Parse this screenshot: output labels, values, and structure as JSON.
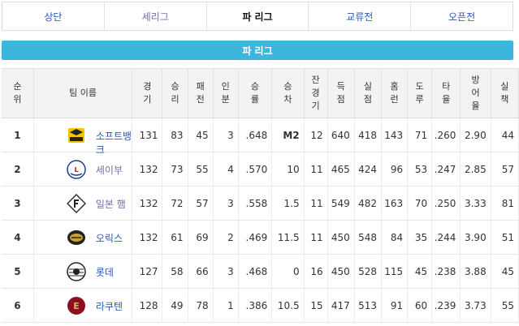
{
  "tabs": [
    {
      "label": "상단",
      "style": "link"
    },
    {
      "label": "세리그",
      "style": "muted"
    },
    {
      "label": "파 리그",
      "style": "active"
    },
    {
      "label": "교류전",
      "style": "link"
    },
    {
      "label": "오픈전",
      "style": "link"
    }
  ],
  "banner": {
    "title": "파 리그"
  },
  "table": {
    "headers": [
      "순위",
      "팀 이름",
      "경기",
      "승리",
      "패전",
      "인분",
      "승률",
      "승차",
      "잔경기",
      "득점",
      "실점",
      "홈런",
      "도루",
      "타율",
      "방어율",
      "실책"
    ],
    "rows": [
      {
        "rank": "1",
        "team": "소프트뱅크",
        "logo": "hawks-logo",
        "link_style": "blue",
        "g": "131",
        "w": "83",
        "l": "45",
        "d": "3",
        "pct": ".648",
        "gb": "M2",
        "gb_bold": true,
        "rem": "12",
        "rs": "640",
        "ra": "418",
        "hr": "143",
        "sb": "71",
        "avg": ".260",
        "era": "2.90",
        "err": "44"
      },
      {
        "rank": "2",
        "team": "세이부",
        "logo": "lions-logo",
        "link_style": "purple",
        "g": "132",
        "w": "73",
        "l": "55",
        "d": "4",
        "pct": ".570",
        "gb": "10",
        "gb_bold": false,
        "rem": "11",
        "rs": "465",
        "ra": "424",
        "hr": "96",
        "sb": "53",
        "avg": ".247",
        "era": "2.85",
        "err": "57"
      },
      {
        "rank": "3",
        "team": "일본 햄",
        "logo": "fighters-logo",
        "link_style": "purple",
        "g": "132",
        "w": "72",
        "l": "57",
        "d": "3",
        "pct": ".558",
        "gb": "1.5",
        "gb_bold": false,
        "rem": "11",
        "rs": "549",
        "ra": "482",
        "hr": "163",
        "sb": "70",
        "avg": ".250",
        "era": "3.33",
        "err": "81"
      },
      {
        "rank": "4",
        "team": "오릭스",
        "logo": "buffaloes-logo",
        "link_style": "blue",
        "g": "132",
        "w": "61",
        "l": "69",
        "d": "2",
        "pct": ".469",
        "gb": "11.5",
        "gb_bold": false,
        "rem": "11",
        "rs": "450",
        "ra": "548",
        "hr": "84",
        "sb": "35",
        "avg": ".244",
        "era": "3.90",
        "err": "51"
      },
      {
        "rank": "5",
        "team": "롯데",
        "logo": "marines-logo",
        "link_style": "blue",
        "g": "127",
        "w": "58",
        "l": "66",
        "d": "3",
        "pct": ".468",
        "gb": "0",
        "gb_bold": false,
        "rem": "16",
        "rs": "450",
        "ra": "528",
        "hr": "115",
        "sb": "45",
        "avg": ".238",
        "era": "3.88",
        "err": "45"
      },
      {
        "rank": "6",
        "team": "라쿠텐",
        "logo": "eagles-logo",
        "link_style": "blue",
        "g": "128",
        "w": "49",
        "l": "78",
        "d": "1",
        "pct": ".386",
        "gb": "10.5",
        "gb_bold": false,
        "rem": "15",
        "rs": "417",
        "ra": "513",
        "hr": "91",
        "sb": "60",
        "avg": ".239",
        "era": "3.73",
        "err": "55"
      }
    ]
  },
  "colors": {
    "banner": "#3cb6dc",
    "link": "#2a5ab0",
    "visited": "#7d6aa6"
  }
}
